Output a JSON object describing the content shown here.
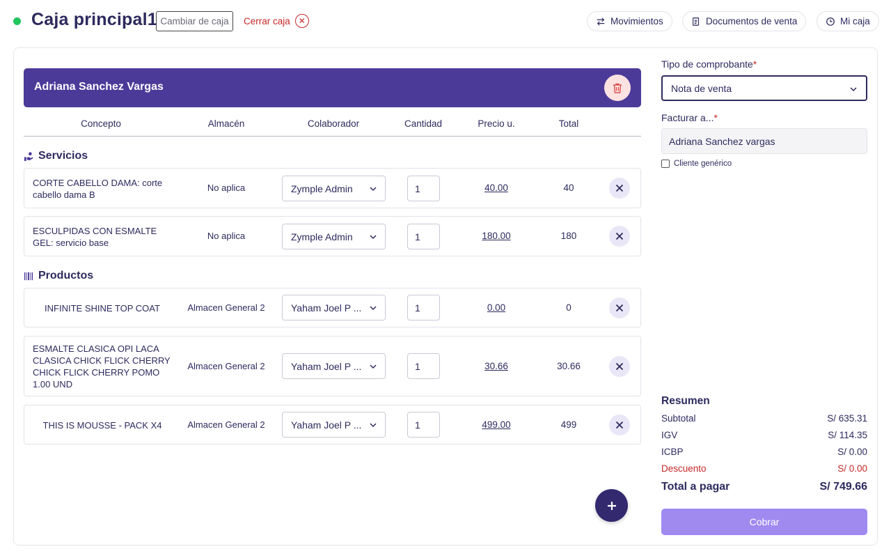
{
  "header": {
    "title": "Caja principal1",
    "change_label": "Cambiar de caja",
    "close_label": "Cerrar caja",
    "nav": [
      {
        "label": "Movimientos",
        "icon": "arrows-swap-icon"
      },
      {
        "label": "Documentos de venta",
        "icon": "document-icon"
      },
      {
        "label": "Mi caja",
        "icon": "clock-icon"
      }
    ],
    "status_color": "#22c55e"
  },
  "client": {
    "name": "Adriana Sanchez Vargas",
    "bar_color": "#4c3a99"
  },
  "columns": [
    "Concepto",
    "Almacén",
    "Colaborador",
    "Cantidad",
    "Precio u.",
    "Total"
  ],
  "services": {
    "title": "Servicios",
    "items": [
      {
        "concept": "CORTE CABELLO DAMA: corte cabello dama B",
        "almacen": "No aplica",
        "collaborator": "Zymple Admin",
        "qty": "1",
        "price": "40.00",
        "total": "40"
      },
      {
        "concept": "ESCULPIDAS CON ESMALTE GEL: servicio base",
        "almacen": "No aplica",
        "collaborator": "Zymple Admin",
        "qty": "1",
        "price": "180.00",
        "total": "180"
      }
    ]
  },
  "products": {
    "title": "Productos",
    "items": [
      {
        "concept": "INFINITE SHINE TOP COAT",
        "almacen": "Almacen General 2",
        "collaborator": "Yaham Joel P ...",
        "qty": "1",
        "price": "0.00",
        "total": "0"
      },
      {
        "concept": "ESMALTE CLASICA OPI LACA CLASICA CHICK FLICK CHERRY CHICK FLICK CHERRY POMO 1.00 UND",
        "almacen": "Almacen General 2",
        "collaborator": "Yaham Joel P ...",
        "qty": "1",
        "price": "30.66",
        "total": "30.66"
      },
      {
        "concept": "THIS IS MOUSSE - PACK X4",
        "almacen": "Almacen General 2",
        "collaborator": "Yaham Joel P ...",
        "qty": "1",
        "price": "499.00",
        "total": "499"
      }
    ]
  },
  "billing": {
    "doc_type_label": "Tipo de comprobante",
    "doc_type_value": "Nota de venta",
    "bill_to_label": "Facturar a...",
    "bill_to_value": "Adriana Sanchez vargas",
    "generic_client_label": "Cliente genérico",
    "generic_client_checked": false
  },
  "summary": {
    "title": "Resumen",
    "subtotal_label": "Subtotal",
    "subtotal": "S/ 635.31",
    "igv_label": "IGV",
    "igv": "S/ 114.35",
    "icbp_label": "ICBP",
    "icbp": "S/ 0.00",
    "discount_label": "Descuento",
    "discount": "S/ 0.00",
    "total_label": "Total a pagar",
    "total": "S/ 749.66",
    "pay_label": "Cobrar",
    "pay_color": "#a08af0"
  }
}
